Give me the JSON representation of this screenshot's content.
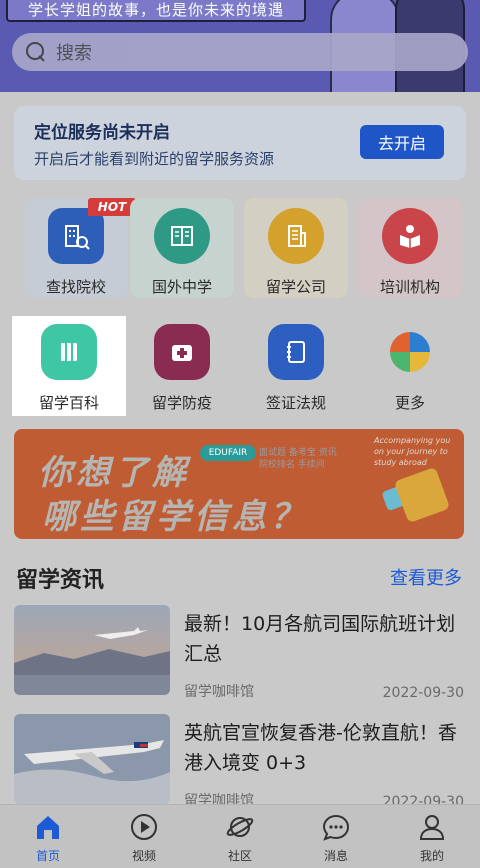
{
  "header": {
    "tagline": "学长学姐的故事，也是你未来的境遇",
    "search_placeholder": "搜索"
  },
  "location": {
    "title": "定位服务尚未开启",
    "subtitle": "开启后才能看到附近的留学服务资源",
    "button": "去开启"
  },
  "grid": [
    {
      "label": "查找院校",
      "badge": "HOT",
      "color": "#2d5fb8",
      "icon": "school-search-icon"
    },
    {
      "label": "国外中学",
      "color": "#2e9a86",
      "icon": "book-icon"
    },
    {
      "label": "留学公司",
      "color": "#d4a22c",
      "icon": "building-icon"
    },
    {
      "label": "培训机构",
      "color": "#c9454a",
      "icon": "reading-icon"
    },
    {
      "label": "留学百科",
      "color": "#3fc6a4",
      "icon": "encyclopedia-icon"
    },
    {
      "label": "留学防疫",
      "color": "#8a2b52",
      "icon": "medical-kit-icon"
    },
    {
      "label": "签证法规",
      "color": "#2c5fbf",
      "icon": "notebook-icon"
    },
    {
      "label": "更多",
      "color": "#e0632f",
      "icon": "more-petals-icon"
    }
  ],
  "banner": {
    "line1": "你想了解",
    "line2": "哪些留学信息？",
    "tag": "EDUFAIR",
    "mini": "面试题 备考宝 资讯\n院校排名 手续问",
    "english": "Accompanying you on your journey to study abroad"
  },
  "news_section": {
    "title": "留学资讯",
    "more": "查看更多",
    "items": [
      {
        "title": "最新！10月各航司国际航班计划汇总",
        "source": "留学咖啡馆",
        "date": "2022-09-30"
      },
      {
        "title": "英航官宣恢复香港-伦敦直航！香港入境变 0+3",
        "source": "留学咖啡馆",
        "date": "2022-09-30"
      }
    ]
  },
  "tabs": [
    {
      "label": "首页",
      "icon": "home-icon",
      "active": true
    },
    {
      "label": "视频",
      "icon": "play-icon"
    },
    {
      "label": "社区",
      "icon": "planet-icon"
    },
    {
      "label": "消息",
      "icon": "chat-bubble-icon"
    },
    {
      "label": "我的",
      "icon": "user-icon"
    }
  ],
  "colors": {
    "accent": "#1d5ad6",
    "header_bg": "#5a5ab2",
    "banner_bg": "#bf5c34"
  }
}
